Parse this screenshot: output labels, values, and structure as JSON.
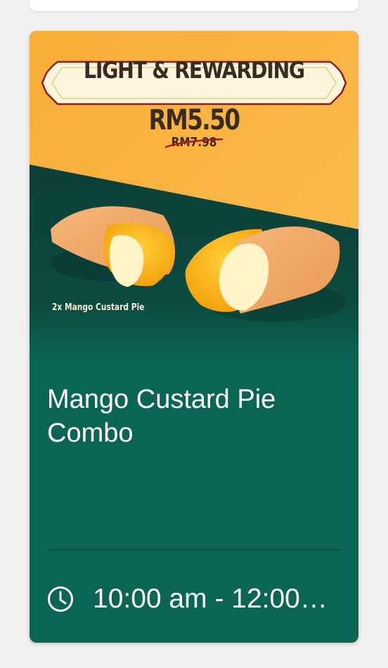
{
  "promo": {
    "banner_label": "LIGHT & REWARDING",
    "price": "RM5.50",
    "old_price": "RM7.98",
    "item_caption": "2x Mango Custard Pie"
  },
  "offer": {
    "title": "Mango Custard Pie Combo",
    "hours": "10:00 am - 12:00…"
  },
  "icons": {
    "clock": "clock-icon"
  },
  "colors": {
    "card_green": "#0b6555",
    "banner_orange": "#f9b443",
    "label_cream": "#fdf6dc",
    "label_border": "#8c1e1e",
    "text_brown": "#3a2b22"
  }
}
